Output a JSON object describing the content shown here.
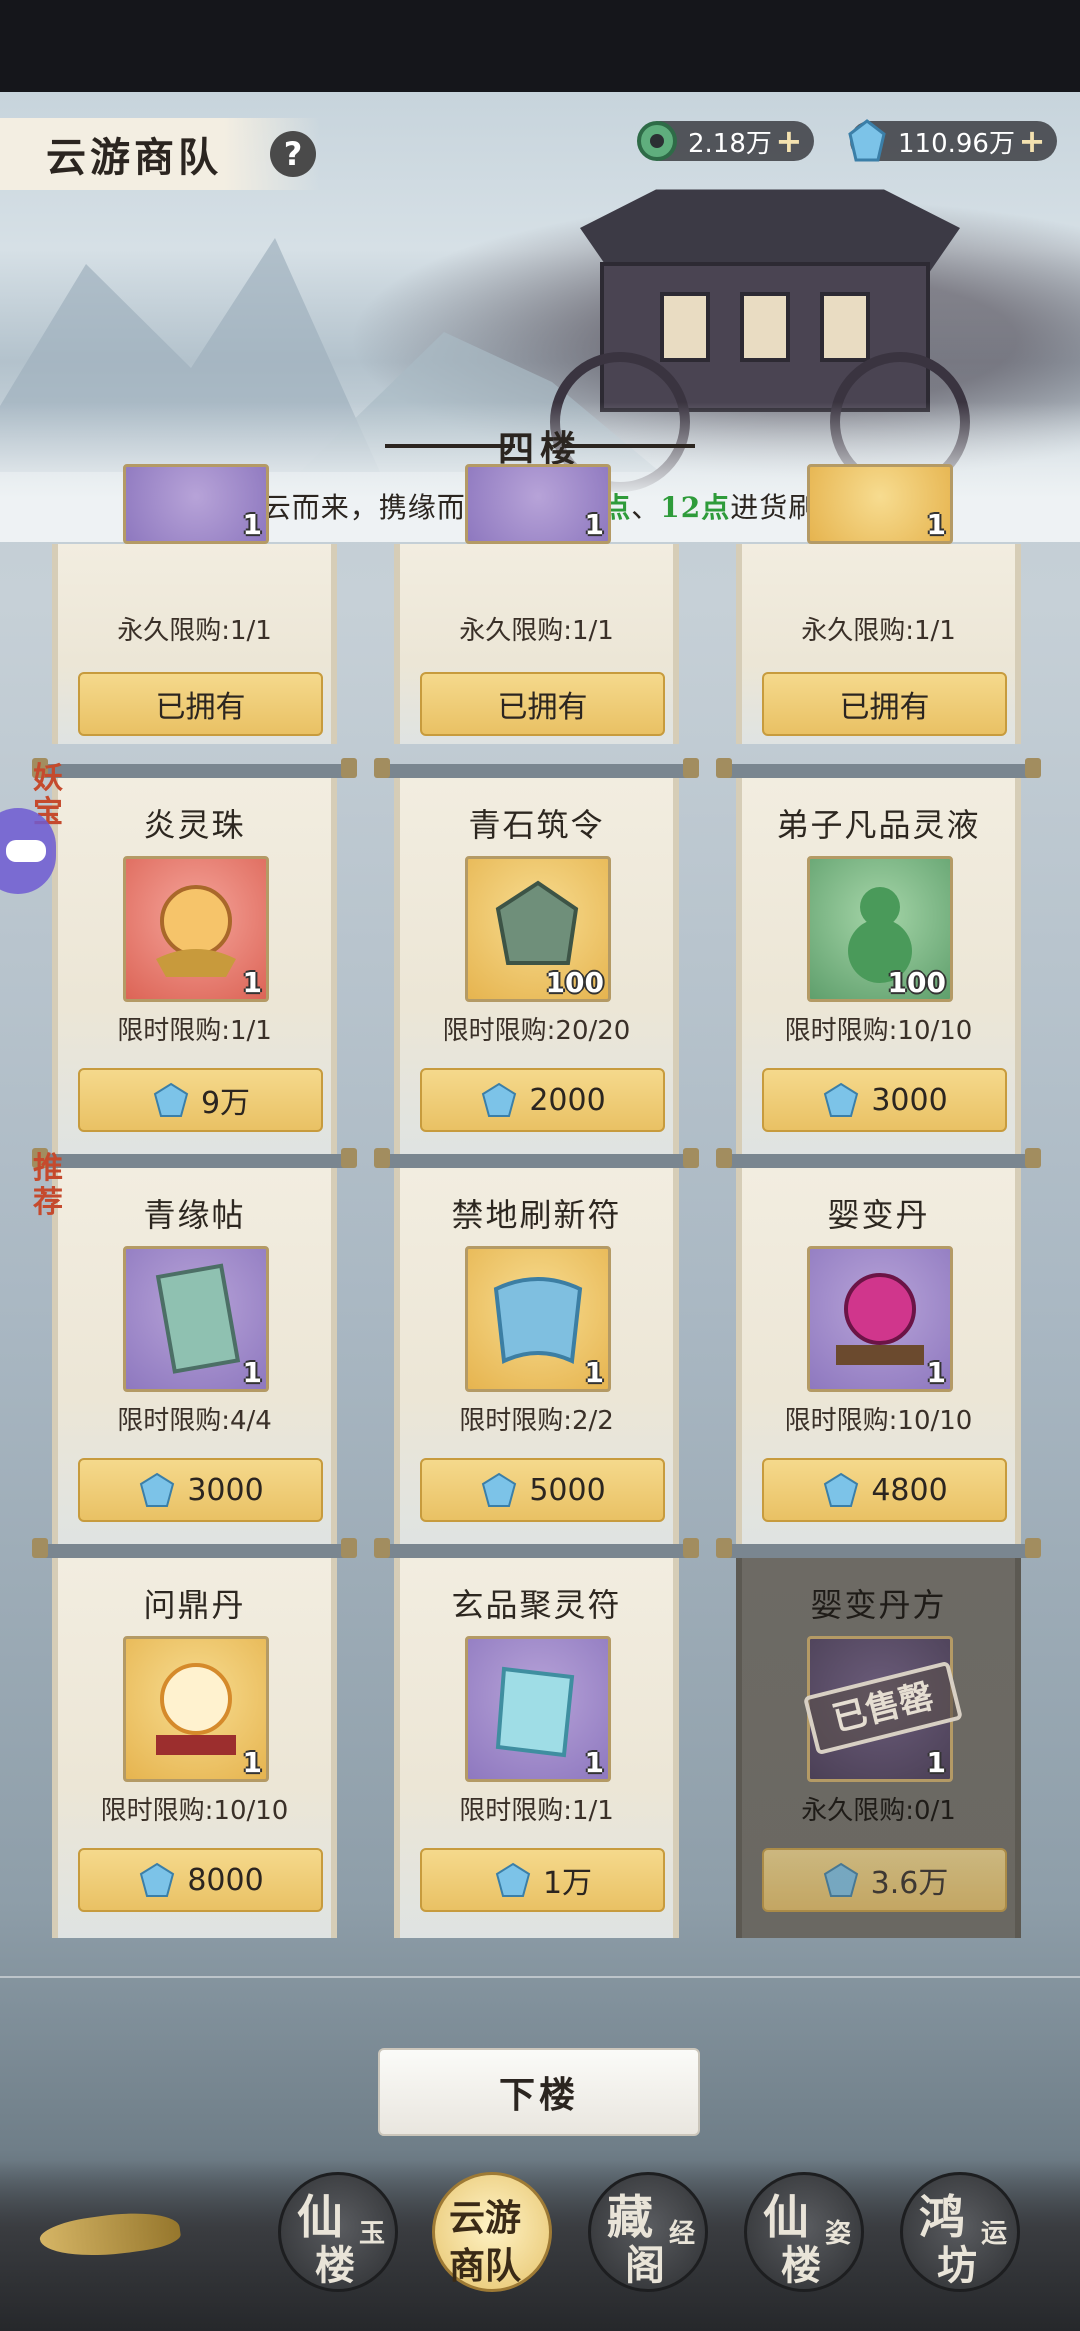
{
  "header": {
    "title": "云游商队",
    "help_label": "?",
    "currencies": [
      {
        "name": "jade-coin",
        "value": "2.18万",
        "plus": "+"
      },
      {
        "name": "spirit-stone",
        "value": "110.96万",
        "plus": "+"
      }
    ]
  },
  "floor": {
    "title": "四楼",
    "subtitle_parts": [
      "踏云而来，携缘而售，每日",
      "0点",
      "、",
      "12点",
      "进货刷新"
    ]
  },
  "top_row": [
    {
      "limit": "永久限购:1/1",
      "button": "已拥有",
      "qty": "1"
    },
    {
      "limit": "永久限购:1/1",
      "button": "已拥有",
      "qty": "1"
    },
    {
      "limit": "永久限购:1/1",
      "button": "已拥有",
      "qty": "1"
    }
  ],
  "tags": {
    "row2": "妖宝",
    "row3": "推荐"
  },
  "items": [
    {
      "name": "炎灵珠",
      "qty": "1",
      "limit": "限时限购:1/1",
      "price": "9万"
    },
    {
      "name": "青石筑令",
      "qty": "100",
      "limit": "限时限购:20/20",
      "price": "2000"
    },
    {
      "name": "弟子凡品灵液",
      "qty": "100",
      "limit": "限时限购:10/10",
      "price": "3000"
    },
    {
      "name": "青缘帖",
      "qty": "1",
      "limit": "限时限购:4/4",
      "price": "3000"
    },
    {
      "name": "禁地刷新符",
      "qty": "1",
      "limit": "限时限购:2/2",
      "price": "5000"
    },
    {
      "name": "婴变丹",
      "qty": "1",
      "limit": "限时限购:10/10",
      "price": "4800"
    },
    {
      "name": "问鼎丹",
      "qty": "1",
      "limit": "限时限购:10/10",
      "price": "8000"
    },
    {
      "name": "玄品聚灵符",
      "qty": "1",
      "limit": "限时限购:1/1",
      "price": "1万"
    },
    {
      "name": "婴变丹方",
      "qty": "1",
      "limit": "永久限购:0/1",
      "price": "3.6万",
      "stamp": "已售罄"
    }
  ],
  "down_button": "下楼",
  "nav": [
    {
      "big": "仙",
      "big2": "楼",
      "small": "玉"
    },
    {
      "big": "云游",
      "big2": "商队",
      "small": ""
    },
    {
      "big": "藏",
      "big2": "阁",
      "small": "经"
    },
    {
      "big": "仙",
      "big2": "楼",
      "small": "姿"
    },
    {
      "big": "鸿",
      "big2": "坊",
      "small": "运"
    }
  ]
}
